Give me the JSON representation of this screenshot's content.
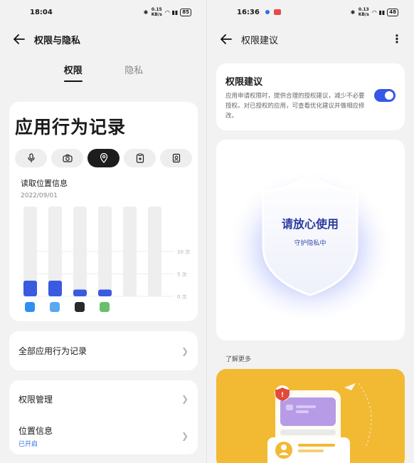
{
  "left": {
    "status": {
      "time": "18:04",
      "net_speed": "0.15 KB/s",
      "battery": "85"
    },
    "header": {
      "title": "权限与隐私"
    },
    "tabs": [
      {
        "label": "权限"
      },
      {
        "label": "隐私"
      }
    ],
    "behavior": {
      "title": "应用行为记录",
      "chips": [
        "microphone-icon",
        "camera-icon",
        "location-icon",
        "clipboard-icon",
        "contacts-icon"
      ],
      "active_chip": 2,
      "chart_label": "读取位置信息",
      "chart_date": "2022/09/01"
    },
    "chart_data": {
      "type": "bar",
      "categories": [
        "app-1",
        "app-2",
        "app-3",
        "app-4",
        "",
        ""
      ],
      "values": [
        3.5,
        3.5,
        1.5,
        1.5,
        0,
        0
      ],
      "ylim": [
        0,
        20
      ],
      "yticks": [
        "10 次",
        "5 次",
        "0 次"
      ],
      "bar_color": "#3a5ae0",
      "track_color": "#eeeeee"
    },
    "rows": {
      "all_records": "全部应用行为记录",
      "permission_mgmt": "权限管理",
      "location_info": "位置信息",
      "location_status": "已开启"
    }
  },
  "right": {
    "status": {
      "time": "16:36",
      "net_speed": "0.13 KB/s",
      "battery": "48"
    },
    "header": {
      "title": "权限建议"
    },
    "recommendation": {
      "title": "权限建议",
      "description": "应用申请权限时，提供合理的授权建议，减少不必要授权。对已授权的应用，可查看优化建议并做相应修改。",
      "enabled": true
    },
    "shield": {
      "title": "请放心使用",
      "subtitle": "守护隐私中"
    },
    "learn_more": "了解更多"
  },
  "colors": {
    "accent": "#3558e6",
    "link": "#2f6fe0",
    "promo_bg": "#f2b933"
  }
}
